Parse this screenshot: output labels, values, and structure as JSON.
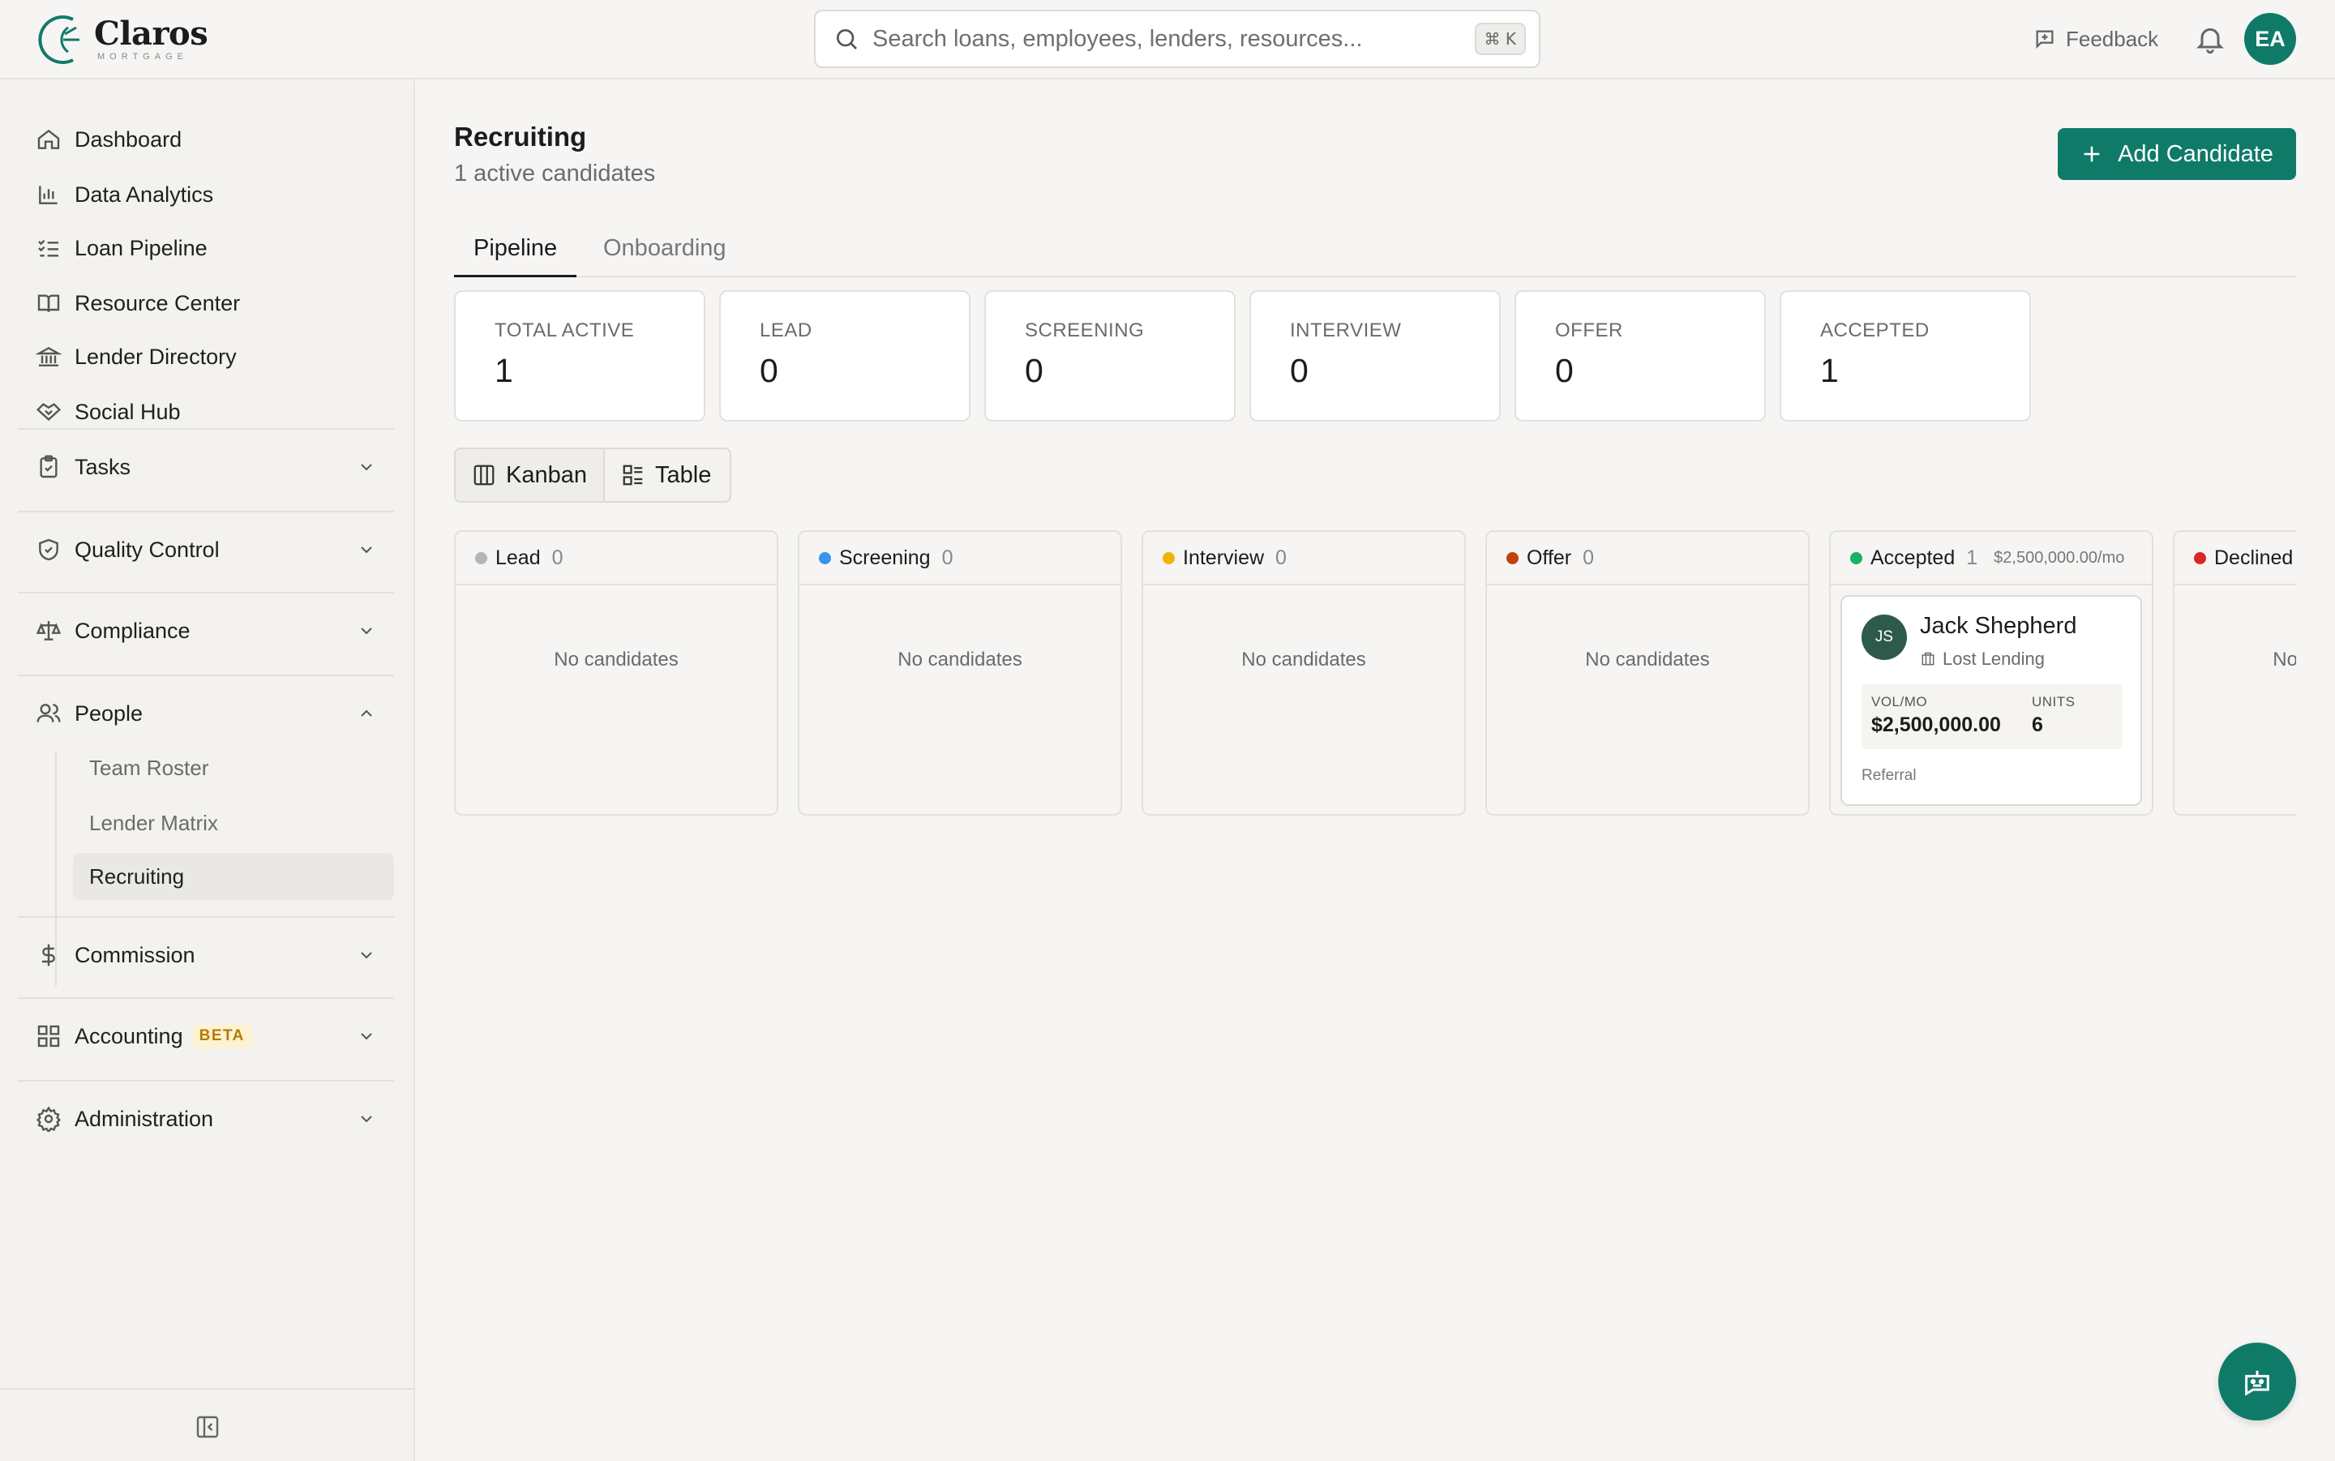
{
  "brand": {
    "name": "Claros",
    "tagline": "MORTGAGE"
  },
  "header": {
    "search_placeholder": "Search loans, employees, lenders, resources...",
    "search_shortcut": "⌘ K",
    "feedback_label": "Feedback",
    "user_initials": "EA"
  },
  "sidebar": {
    "top_items": [
      {
        "label": "Dashboard",
        "icon": "home-icon"
      },
      {
        "label": "Data Analytics",
        "icon": "bar-chart-icon"
      },
      {
        "label": "Loan Pipeline",
        "icon": "list-check-icon"
      },
      {
        "label": "Resource Center",
        "icon": "book-icon"
      },
      {
        "label": "Lender Directory",
        "icon": "bank-icon"
      },
      {
        "label": "Social Hub",
        "icon": "handshake-icon"
      }
    ],
    "groups": [
      {
        "label": "Tasks",
        "icon": "clipboard-check-icon",
        "expanded": false
      },
      {
        "label": "Quality Control",
        "icon": "shield-check-icon",
        "expanded": false
      },
      {
        "label": "Compliance",
        "icon": "scale-icon",
        "expanded": false
      },
      {
        "label": "People",
        "icon": "users-icon",
        "expanded": true,
        "children": [
          {
            "label": "Team Roster",
            "active": false
          },
          {
            "label": "Lender Matrix",
            "active": false
          },
          {
            "label": "Recruiting",
            "active": true
          }
        ]
      },
      {
        "label": "Commission",
        "icon": "dollar-icon",
        "expanded": false
      },
      {
        "label": "Accounting",
        "icon": "grid-icon",
        "badge": "BETA",
        "expanded": false
      },
      {
        "label": "Administration",
        "icon": "gear-icon",
        "expanded": false
      }
    ]
  },
  "page": {
    "title": "Recruiting",
    "subtitle": "1 active candidates",
    "add_button": "Add Candidate",
    "tabs": [
      {
        "label": "Pipeline",
        "active": true
      },
      {
        "label": "Onboarding",
        "active": false
      }
    ],
    "stats": [
      {
        "label": "TOTAL ACTIVE",
        "value": "1"
      },
      {
        "label": "LEAD",
        "value": "0"
      },
      {
        "label": "SCREENING",
        "value": "0"
      },
      {
        "label": "INTERVIEW",
        "value": "0"
      },
      {
        "label": "OFFER",
        "value": "0"
      },
      {
        "label": "ACCEPTED",
        "value": "1"
      }
    ],
    "views": [
      {
        "label": "Kanban",
        "active": true
      },
      {
        "label": "Table",
        "active": false
      }
    ]
  },
  "kanban": {
    "empty_text": "No candidates",
    "columns": [
      {
        "name": "Lead",
        "count": "0",
        "color": "#b5b5b5"
      },
      {
        "name": "Screening",
        "count": "0",
        "color": "#3b93f0"
      },
      {
        "name": "Interview",
        "count": "0",
        "color": "#f0b400"
      },
      {
        "name": "Offer",
        "count": "0",
        "color": "#c2410c"
      },
      {
        "name": "Accepted",
        "count": "1",
        "sum": "$2,500,000.00/mo",
        "color": "#16b364",
        "cards": [
          {
            "initials": "JS",
            "name": "Jack Shepherd",
            "company": "Lost Lending",
            "vol_label": "VOL/MO",
            "vol_value": "$2,500,000.00",
            "units_label": "UNITS",
            "units_value": "6",
            "source": "Referral"
          }
        ]
      },
      {
        "name": "Declined",
        "count": "",
        "color": "#dc2626"
      }
    ]
  },
  "colors": {
    "accent": "#107a69",
    "background": "#f6f5f3"
  }
}
